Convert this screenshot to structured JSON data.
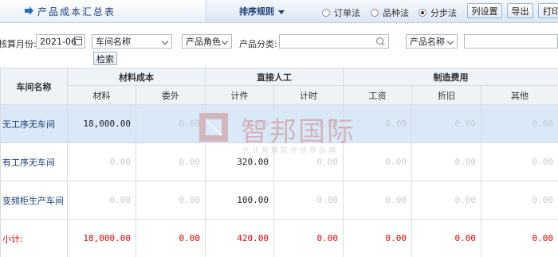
{
  "header": {
    "title": "产品成本汇总表",
    "sort_rule": "排序规则",
    "methods": [
      {
        "label": "订单法",
        "selected": false
      },
      {
        "label": "品种法",
        "selected": false
      },
      {
        "label": "分步法",
        "selected": true
      }
    ],
    "buttons": [
      "列设置",
      "导出",
      "打印"
    ]
  },
  "filters": {
    "period_label": "核算月份:",
    "period_value": "2021-06",
    "workshop_select": "车间名称",
    "product_role_select": "产品角色",
    "category_label": "产品分类:",
    "category_value": "",
    "product_name_select": "产品名称",
    "keyword_value": "",
    "query_button": "检索"
  },
  "table": {
    "row_header": "车间名称",
    "groups": [
      "材料成本",
      "直接人工",
      "制造费用"
    ],
    "columns": [
      "材料",
      "委外",
      "计件",
      "计时",
      "工资",
      "折旧",
      "其他"
    ],
    "rows": [
      {
        "name": "无工序无车间",
        "values": [
          "18,000.00",
          "0.00",
          "0.00",
          "0.00",
          "0.00",
          "0.00",
          "0.00"
        ]
      },
      {
        "name": "有工序无车间",
        "values": [
          "0.00",
          "0.00",
          "320.00",
          "0.00",
          "0.00",
          "0.00",
          "0.00"
        ]
      },
      {
        "name": "变频柜生产车间",
        "values": [
          "0.00",
          "0.00",
          "100.00",
          "0.00",
          "0.00",
          "0.00",
          "0.00"
        ]
      }
    ],
    "total": {
      "name": "小计:",
      "values": [
        "18,000.00",
        "0.00",
        "420.00",
        "0.00",
        "0.00",
        "0.00",
        "0.00"
      ]
    }
  },
  "watermark": {
    "text": "智邦国际",
    "subtext": "企业管理软件领导品牌"
  },
  "colors": {
    "header_blue": "#1a3f77",
    "highlight_row": "#dbe8f7",
    "total_red": "#e00000"
  }
}
